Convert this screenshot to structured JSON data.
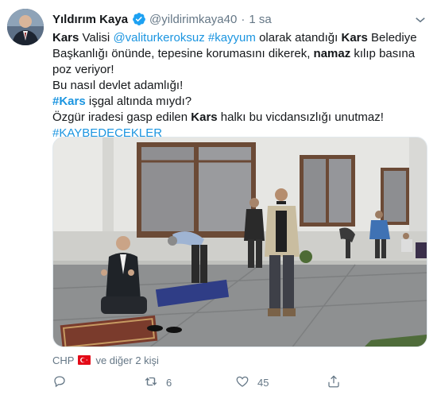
{
  "tweet": {
    "display_name": "Yıldırım Kaya",
    "handle": "@yildirimkaya40",
    "separator": "·",
    "time": "1 sa",
    "verified_icon": "verified-badge-icon",
    "caret_icon": "chevron-down-icon",
    "text": {
      "line1": {
        "w1": "Kars",
        "t1": " Valisi ",
        "m1": "@valiturkeroksuz",
        "t2": " ",
        "h1": "#kayyum",
        "t3": " olarak atandığı ",
        "w2": "Kars",
        "t4": " Belediye Başkanlığı önünde, tepesine korumasını dikerek, ",
        "w3": "namaz",
        "t5": " kılıp basına poz veriyor!"
      },
      "line2": "Bu nasıl devlet adamlığı!",
      "line3": {
        "h": "#Kars",
        "t": " işgal altında mıydı?"
      },
      "line4": {
        "t1": "Özgür iradesi gasp edilen ",
        "w": "Kars",
        "t2": " halkı bu vicdansızlığı unutmaz!"
      },
      "line5": "#KAYBEDECEKLER"
    },
    "footer": {
      "party": "CHP",
      "flag_icon": "turkey-flag-icon",
      "others": "ve diğer 2 kişi"
    },
    "actions": {
      "reply_icon": "reply-icon",
      "retweet_icon": "retweet-icon",
      "retweet_count": "6",
      "like_icon": "heart-icon",
      "like_count": "45",
      "share_icon": "share-icon"
    },
    "colors": {
      "accent": "#1b95e0",
      "secondary": "#657786",
      "text": "#14171a"
    }
  }
}
